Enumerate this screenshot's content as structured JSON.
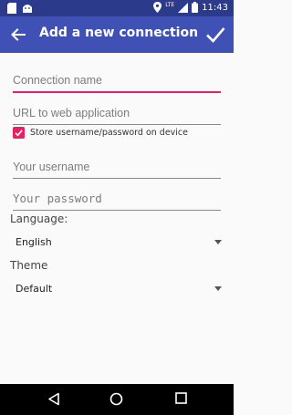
{
  "status_bar": {
    "time": "11:43",
    "network": "LTE"
  },
  "app_bar": {
    "title": "Add a new connection"
  },
  "form": {
    "connection_name_placeholder": "Connection name",
    "url_placeholder": "URL to web application",
    "store_credentials_label": "Store username/password on device",
    "store_credentials_checked": true,
    "username_placeholder": "Your username",
    "password_placeholder": "Your password",
    "language_label": "Language:",
    "language_value": "English",
    "theme_label": "Theme",
    "theme_value": "Default"
  },
  "colors": {
    "app_bar": "#3f51b5",
    "status_bar": "#2c3a8c",
    "accent": "#e91e63"
  }
}
